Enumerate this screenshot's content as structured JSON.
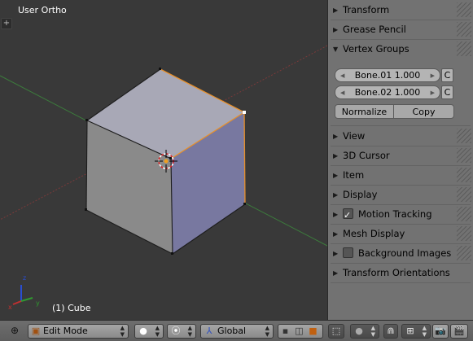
{
  "viewport": {
    "title": "User Ortho",
    "object_label": "(1) Cube",
    "add_icon": "+"
  },
  "panel": {
    "sections": [
      {
        "label": "Transform",
        "expanded": false
      },
      {
        "label": "Grease Pencil",
        "expanded": false
      },
      {
        "label": "Vertex Groups",
        "expanded": true
      },
      {
        "label": "View",
        "expanded": false
      },
      {
        "label": "3D Cursor",
        "expanded": false
      },
      {
        "label": "Item",
        "expanded": false
      },
      {
        "label": "Display",
        "expanded": false
      },
      {
        "label": "Motion Tracking",
        "expanded": false,
        "checkbox": true
      },
      {
        "label": "Mesh Display",
        "expanded": false
      },
      {
        "label": "Background Images",
        "expanded": false,
        "checkbox": false
      },
      {
        "label": "Transform Orientations",
        "expanded": false
      }
    ],
    "vertex_groups": [
      {
        "label": "Bone.01 1.000",
        "button": "C"
      },
      {
        "label": "Bone.02 1.000",
        "button": "C"
      }
    ],
    "normalize_label": "Normalize",
    "copy_label": "Copy"
  },
  "toolbar": {
    "mode": "Edit Mode",
    "orientation": "Global"
  },
  "colors": {
    "viewport_bg": "#393939",
    "panel_bg": "#727272",
    "cube_top": "#a9a9b8",
    "cube_left": "#8d8d8d",
    "cube_right": "#7a7a9a",
    "edge_selected": "#e8902a",
    "x_axis": "#8a3a3a",
    "y_axis": "#3a8a3a"
  }
}
